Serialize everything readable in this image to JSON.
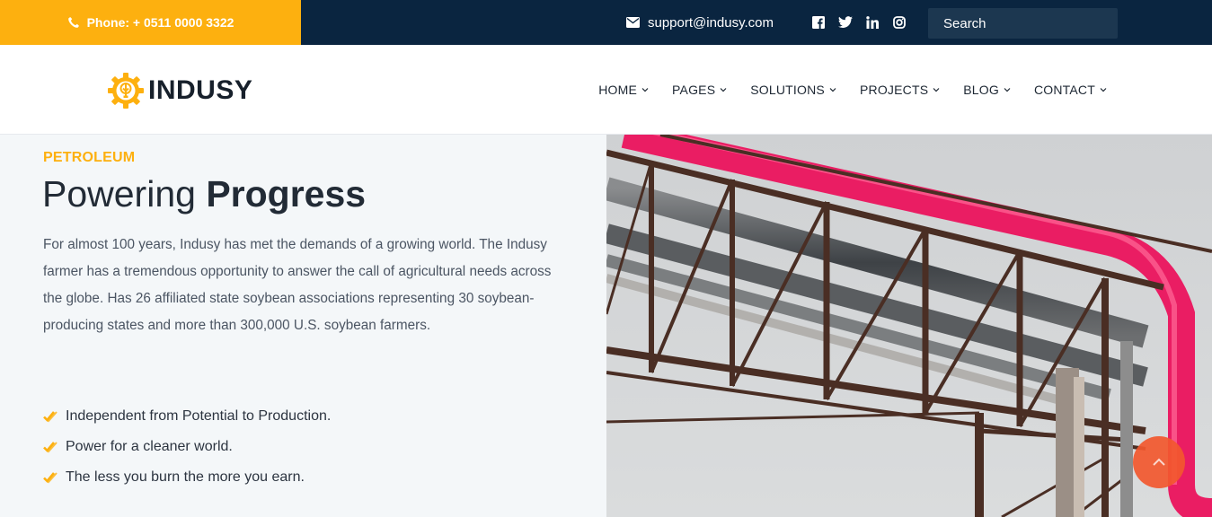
{
  "topbar": {
    "phone_label": "Phone: + 0511 0000 3322",
    "email": "support@indusy.com",
    "social_icons": [
      "facebook-icon",
      "twitter-icon",
      "linkedin-icon",
      "instagram-icon"
    ],
    "search_placeholder": "Search"
  },
  "brand": {
    "name": "INDUSY",
    "accent": "#fdb00f",
    "dark": "#0a2540"
  },
  "nav": {
    "items": [
      {
        "label": "HOME"
      },
      {
        "label": "PAGES"
      },
      {
        "label": "SOLUTIONS"
      },
      {
        "label": "PROJECTS"
      },
      {
        "label": "BLOG"
      },
      {
        "label": "CONTACT"
      }
    ]
  },
  "hero": {
    "eyebrow": "PETROLEUM",
    "title_light": "Powering ",
    "title_bold": "Progress",
    "paragraph": "For almost 100 years, Indusy has met the demands of a growing world. The Indusy farmer has a tremendous opportunity to answer the call of agricultural needs across the globe. Has 26 affiliated state soybean associations representing 30 soybean-producing states and more than 300,000 U.S. soybean farmers.",
    "checklist": [
      "Independent from Potential to Production.",
      "Power for a cleaner world.",
      "The less you burn the more you earn."
    ]
  }
}
